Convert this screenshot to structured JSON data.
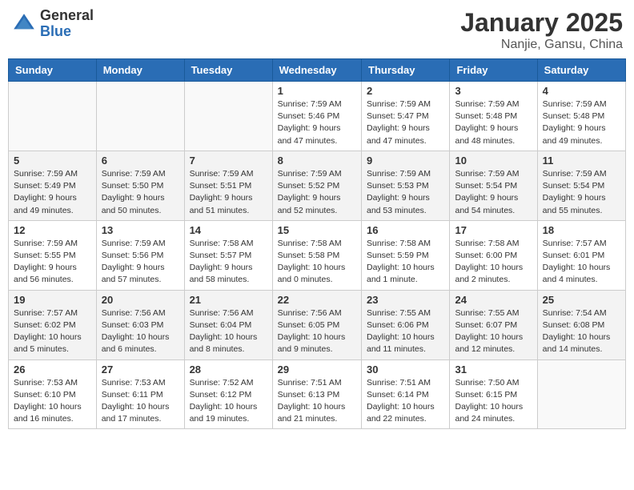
{
  "header": {
    "logo_general": "General",
    "logo_blue": "Blue",
    "month_title": "January 2025",
    "location": "Nanjie, Gansu, China"
  },
  "days_of_week": [
    "Sunday",
    "Monday",
    "Tuesday",
    "Wednesday",
    "Thursday",
    "Friday",
    "Saturday"
  ],
  "weeks": [
    {
      "days": [
        {
          "number": "",
          "info": ""
        },
        {
          "number": "",
          "info": ""
        },
        {
          "number": "",
          "info": ""
        },
        {
          "number": "1",
          "info": "Sunrise: 7:59 AM\nSunset: 5:46 PM\nDaylight: 9 hours and 47 minutes."
        },
        {
          "number": "2",
          "info": "Sunrise: 7:59 AM\nSunset: 5:47 PM\nDaylight: 9 hours and 47 minutes."
        },
        {
          "number": "3",
          "info": "Sunrise: 7:59 AM\nSunset: 5:48 PM\nDaylight: 9 hours and 48 minutes."
        },
        {
          "number": "4",
          "info": "Sunrise: 7:59 AM\nSunset: 5:48 PM\nDaylight: 9 hours and 49 minutes."
        }
      ]
    },
    {
      "days": [
        {
          "number": "5",
          "info": "Sunrise: 7:59 AM\nSunset: 5:49 PM\nDaylight: 9 hours and 49 minutes."
        },
        {
          "number": "6",
          "info": "Sunrise: 7:59 AM\nSunset: 5:50 PM\nDaylight: 9 hours and 50 minutes."
        },
        {
          "number": "7",
          "info": "Sunrise: 7:59 AM\nSunset: 5:51 PM\nDaylight: 9 hours and 51 minutes."
        },
        {
          "number": "8",
          "info": "Sunrise: 7:59 AM\nSunset: 5:52 PM\nDaylight: 9 hours and 52 minutes."
        },
        {
          "number": "9",
          "info": "Sunrise: 7:59 AM\nSunset: 5:53 PM\nDaylight: 9 hours and 53 minutes."
        },
        {
          "number": "10",
          "info": "Sunrise: 7:59 AM\nSunset: 5:54 PM\nDaylight: 9 hours and 54 minutes."
        },
        {
          "number": "11",
          "info": "Sunrise: 7:59 AM\nSunset: 5:54 PM\nDaylight: 9 hours and 55 minutes."
        }
      ]
    },
    {
      "days": [
        {
          "number": "12",
          "info": "Sunrise: 7:59 AM\nSunset: 5:55 PM\nDaylight: 9 hours and 56 minutes."
        },
        {
          "number": "13",
          "info": "Sunrise: 7:59 AM\nSunset: 5:56 PM\nDaylight: 9 hours and 57 minutes."
        },
        {
          "number": "14",
          "info": "Sunrise: 7:58 AM\nSunset: 5:57 PM\nDaylight: 9 hours and 58 minutes."
        },
        {
          "number": "15",
          "info": "Sunrise: 7:58 AM\nSunset: 5:58 PM\nDaylight: 10 hours and 0 minutes."
        },
        {
          "number": "16",
          "info": "Sunrise: 7:58 AM\nSunset: 5:59 PM\nDaylight: 10 hours and 1 minute."
        },
        {
          "number": "17",
          "info": "Sunrise: 7:58 AM\nSunset: 6:00 PM\nDaylight: 10 hours and 2 minutes."
        },
        {
          "number": "18",
          "info": "Sunrise: 7:57 AM\nSunset: 6:01 PM\nDaylight: 10 hours and 4 minutes."
        }
      ]
    },
    {
      "days": [
        {
          "number": "19",
          "info": "Sunrise: 7:57 AM\nSunset: 6:02 PM\nDaylight: 10 hours and 5 minutes."
        },
        {
          "number": "20",
          "info": "Sunrise: 7:56 AM\nSunset: 6:03 PM\nDaylight: 10 hours and 6 minutes."
        },
        {
          "number": "21",
          "info": "Sunrise: 7:56 AM\nSunset: 6:04 PM\nDaylight: 10 hours and 8 minutes."
        },
        {
          "number": "22",
          "info": "Sunrise: 7:56 AM\nSunset: 6:05 PM\nDaylight: 10 hours and 9 minutes."
        },
        {
          "number": "23",
          "info": "Sunrise: 7:55 AM\nSunset: 6:06 PM\nDaylight: 10 hours and 11 minutes."
        },
        {
          "number": "24",
          "info": "Sunrise: 7:55 AM\nSunset: 6:07 PM\nDaylight: 10 hours and 12 minutes."
        },
        {
          "number": "25",
          "info": "Sunrise: 7:54 AM\nSunset: 6:08 PM\nDaylight: 10 hours and 14 minutes."
        }
      ]
    },
    {
      "days": [
        {
          "number": "26",
          "info": "Sunrise: 7:53 AM\nSunset: 6:10 PM\nDaylight: 10 hours and 16 minutes."
        },
        {
          "number": "27",
          "info": "Sunrise: 7:53 AM\nSunset: 6:11 PM\nDaylight: 10 hours and 17 minutes."
        },
        {
          "number": "28",
          "info": "Sunrise: 7:52 AM\nSunset: 6:12 PM\nDaylight: 10 hours and 19 minutes."
        },
        {
          "number": "29",
          "info": "Sunrise: 7:51 AM\nSunset: 6:13 PM\nDaylight: 10 hours and 21 minutes."
        },
        {
          "number": "30",
          "info": "Sunrise: 7:51 AM\nSunset: 6:14 PM\nDaylight: 10 hours and 22 minutes."
        },
        {
          "number": "31",
          "info": "Sunrise: 7:50 AM\nSunset: 6:15 PM\nDaylight: 10 hours and 24 minutes."
        },
        {
          "number": "",
          "info": ""
        }
      ]
    }
  ]
}
